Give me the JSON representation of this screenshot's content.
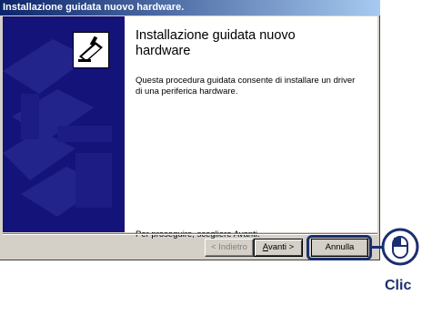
{
  "window": {
    "title": "Installazione guidata nuovo hardware."
  },
  "wizard": {
    "heading": "Installazione guidata nuovo hardware",
    "description": "Questa procedura guidata consente di installare un driver di una periferica hardware.",
    "proceed_text": "Per proseguire, scegliere Avanti."
  },
  "buttons": {
    "back": "< Indietro",
    "next_prefix": "",
    "next_underlined": "A",
    "next_rest": "vanti >",
    "cancel": "Annulla"
  },
  "callout": {
    "label": "Clic",
    "icon": "mouse-icon"
  },
  "colors": {
    "title_bar": "#0a246a",
    "side_panel": "#13137a",
    "callout": "#1b2f6e",
    "dialog_face": "#d4d0c8"
  }
}
